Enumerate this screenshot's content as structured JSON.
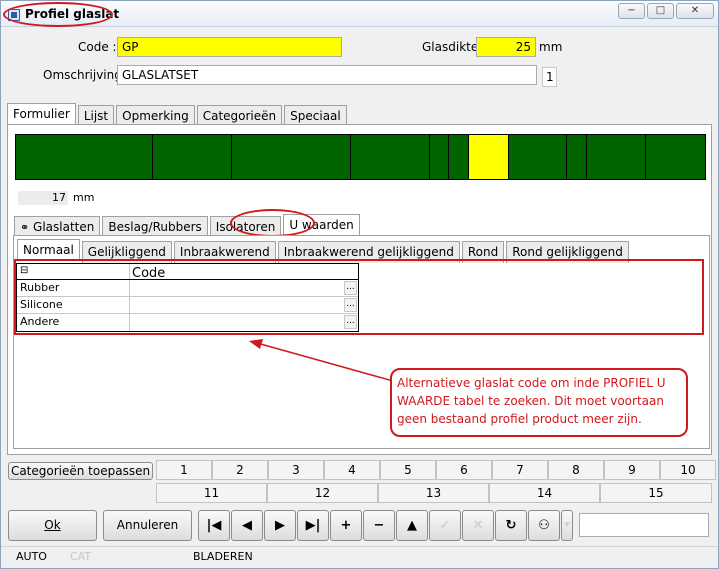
{
  "window": {
    "title": "Profiel glaslat",
    "minimize": "−",
    "restore": "□",
    "close": "✕"
  },
  "form": {
    "code_label": "Code :",
    "code_value": "GP",
    "glasdikte_label": "Glasdikte :",
    "glasdikte_value": "25",
    "glasdikte_unit": "mm",
    "omschrijving_label": "Omschrijving :",
    "omschrijving_value": "GLASLATSET",
    "counter": "1"
  },
  "main_tabs": [
    "Formulier",
    "Lijst",
    "Opmerking",
    "Categorieën",
    "Speciaal"
  ],
  "strip": {
    "colors": {
      "green": "#006400",
      "yellow": "#ffff00"
    },
    "value": "17",
    "unit": "mm"
  },
  "sub_tabs": [
    "Glaslatten",
    "Beslag/Rubbers",
    "Isolatoren",
    "U waarden"
  ],
  "inner_tabs": [
    "Normaal",
    "Gelijkliggend",
    "Inbraakwerend",
    "Inbraakwerend gelijkliggend",
    "Rond",
    "Rond gelijkliggend"
  ],
  "grid": {
    "collapse": "⊟",
    "header": "Code",
    "rows": [
      {
        "label": "Rubber",
        "value": "",
        "btn": "..."
      },
      {
        "label": "Silicone",
        "value": "",
        "btn": "..."
      },
      {
        "label": "Andere",
        "value": "",
        "btn": "..."
      }
    ]
  },
  "callout": "Alternatieve glaslat code om inde PROFIEL U WAARDE tabel te zoeken. Dit moet voortaan geen bestaand profiel product meer zijn.",
  "categories": {
    "apply_button": "Categorieën toepassen",
    "row1": [
      "1",
      "2",
      "3",
      "4",
      "5",
      "6",
      "7",
      "8",
      "9",
      "10"
    ],
    "row2": [
      "11",
      "12",
      "13",
      "14",
      "15"
    ]
  },
  "buttons": {
    "ok": "Ok",
    "annuleren": "Annuleren"
  },
  "nav": {
    "first": "|◀",
    "prev": "◀",
    "next": "▶",
    "last": "▶|",
    "add": "+",
    "remove": "−",
    "up": "▲",
    "confirm": "✓",
    "cancel": "✕",
    "refresh": "↻",
    "find": "⚇",
    "dropdown": "▾"
  },
  "search_value": "",
  "status": {
    "mode": "AUTO",
    "cat": "CAT",
    "state": "BLADEREN"
  }
}
